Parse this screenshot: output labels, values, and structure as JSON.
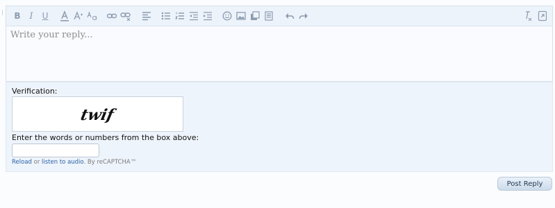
{
  "editor": {
    "placeholder": "Write your reply..."
  },
  "toolbar": {
    "bold": "B",
    "italic": "I",
    "underline": "U"
  },
  "verification": {
    "label": "Verification:",
    "captcha_text": "twif",
    "instructions": "Enter the words or numbers from the box above:",
    "reload_link": "Reload",
    "or_text": "or",
    "audio_link": "listen to audio",
    "by_text": ". By reCAPTCHA™"
  },
  "actions": {
    "post_reply": "Post Reply"
  },
  "colors": {
    "icon": "#8c9cb0",
    "link": "#2b61a6"
  }
}
